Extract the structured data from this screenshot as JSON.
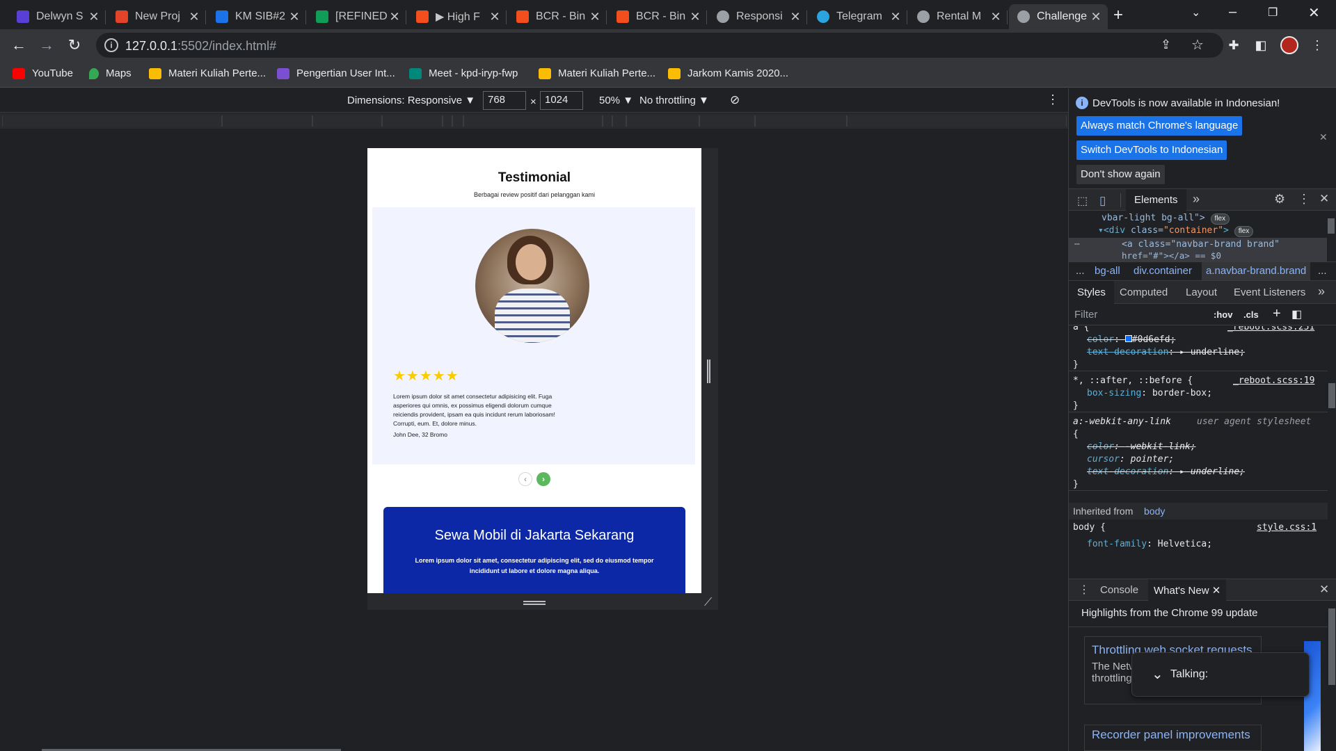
{
  "tabs": [
    {
      "title": "Delwyn S",
      "color": "#5a3fd6"
    },
    {
      "title": "New Proj",
      "color": "#e24329"
    },
    {
      "title": "KM SIB#2",
      "color": "#1a73e8"
    },
    {
      "title": "[REFINED",
      "color": "#0f9d58"
    },
    {
      "title": "▶ High F",
      "color": "#f24e1e"
    },
    {
      "title": "BCR - Bin",
      "color": "#f24e1e"
    },
    {
      "title": "BCR - Bin",
      "color": "#f24e1e"
    },
    {
      "title": "Responsi",
      "color": "#9aa0a6"
    },
    {
      "title": "Telegram",
      "color": "#2aa3df"
    },
    {
      "title": "Rental M",
      "color": "#9aa0a6"
    },
    {
      "title": "Challenge",
      "color": "#9aa0a6"
    }
  ],
  "new_tab": "+",
  "address": {
    "host": "127.0.0.1",
    "path": ":5502/index.html#"
  },
  "bookmarks": [
    {
      "label": "YouTube",
      "color": "#ff0000"
    },
    {
      "label": "Maps",
      "color": "#34a853"
    },
    {
      "label": "Materi Kuliah Perte...",
      "color": "#fbbc04"
    },
    {
      "label": "Pengertian User Int...",
      "color": "#7b4fd1"
    },
    {
      "label": "Meet - kpd-iryp-fwp",
      "color": "#00897b"
    },
    {
      "label": "Materi Kuliah Perte...",
      "color": "#fbbc04"
    },
    {
      "label": "Jarkom Kamis 2020...",
      "color": "#fbbc04"
    }
  ],
  "device_toolbar": {
    "dimensions_label": "Dimensions: Responsive ▼",
    "width": "768",
    "times": "×",
    "height": "1024",
    "zoom": "50% ▼",
    "throttling": "No throttling ▼"
  },
  "page": {
    "title": "Testimonial",
    "subtitle": "Berbagai review positif dari pelanggan kami",
    "stars": "★★★★★",
    "rating": 5,
    "quote": "Lorem ipsum dolor sit amet consectetur adipisicing elit. Fuga asperiores qui omnis, ex possimus eligendi dolorum cumque reiciendis provident, ipsam ea quis incidunt rerum laboriosam! Corrupti, eum. Et, dolore minus.",
    "author": "John Dee, 32 Bromo",
    "prev": "‹",
    "next": "›",
    "cta_title": "Sewa Mobil di Jakarta Sekarang",
    "cta_text": "Lorem ipsum dolor sit amet, consectetur adipiscing elit, sed do eiusmod tempor incididunt ut labore et dolore magna aliqua.",
    "cta_color": "#0d28a6",
    "next_color": "#5cb85f"
  },
  "devtools": {
    "banner_text": "DevTools is now available in Indonesian!",
    "btn_match": "Always match Chrome's language",
    "btn_switch": "Switch DevTools to Indonesian",
    "btn_dont": "Don't show again",
    "main_tab": "Elements",
    "dom": {
      "line1": "vbar-light bg-all\">",
      "line2_tag": "<div",
      "line2_attr": "class=",
      "line2_val": "\"container\"",
      "line2_end": ">",
      "line3": "<a class=\"navbar-brand brand\"",
      "line4": "href=\"#\"></a> == $0",
      "flex": "flex"
    },
    "breadcrumb": [
      "...",
      "bg-all",
      "div.container",
      "a.navbar-brand.brand",
      "..."
    ],
    "subtabs": [
      "Styles",
      "Computed",
      "Layout",
      "Event Listeners"
    ],
    "filter_placeholder": "Filter",
    "hov": ":hov",
    "cls": ".cls",
    "styles": {
      "r1_source": "_reboot.scss:251",
      "r1_color_prop": "color",
      "r1_color_val": "#0d6efd;",
      "r1_td_prop": "text-decoration",
      "r1_td_val": "underline;",
      "r2_selector": "*, ::after, ::before {",
      "r2_source": "_reboot.scss:19",
      "r2_prop": "box-sizing",
      "r2_val": "border-box;",
      "r3_selector": "a:-webkit-any-link",
      "r3_source": "user agent stylesheet",
      "r3_color_prop": "color",
      "r3_color_val": "-webkit-link;",
      "r3_cursor_prop": "cursor",
      "r3_cursor_val": "pointer;",
      "r3_td_prop": "text-decoration",
      "r3_td_val": "underline;",
      "inherited_label": "Inherited from",
      "inherited_el": "body",
      "r4_selector": "body {",
      "r4_source": "style.css:1",
      "r4_prop": "font-family",
      "r4_val": "Helvetica;",
      "open_brace": "{",
      "close_brace": "}"
    },
    "drawer_tabs": [
      "Console",
      "What's New"
    ],
    "whats_new_heading": "Highlights from the Chrome 99 update",
    "card1_title": "Throttling web socket requests",
    "card1_text": "The Network panel now supports throttling web socket requests.",
    "card2_title": "Recorder panel improvements",
    "talking": "Talking:"
  }
}
